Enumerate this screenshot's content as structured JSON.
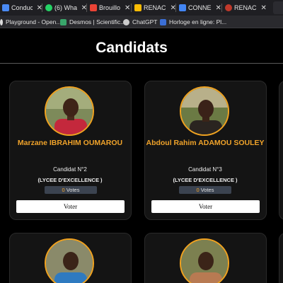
{
  "browser": {
    "tabs": [
      {
        "title": "Conduct",
        "icon": "document-icon",
        "color": "#4a8af4"
      },
      {
        "title": "(6) Wha",
        "icon": "whatsapp-icon",
        "color": "#25d366"
      },
      {
        "title": "Brouillo",
        "icon": "gmail-icon",
        "color": "#ea4335"
      },
      {
        "title": "RENAC",
        "icon": "drive-icon",
        "color": "#fbbc04"
      },
      {
        "title": "CONNE",
        "icon": "document-icon",
        "color": "#4285f4"
      },
      {
        "title": "RENAC",
        "icon": "globe-icon",
        "color": "#c0392b"
      }
    ],
    "bookmarks": [
      {
        "label": "Playground - Open...",
        "icon": "openai-icon",
        "color": "#dddddd"
      },
      {
        "label": "Desmos | Scientific...",
        "icon": "desmos-icon",
        "color": "#39a66b"
      },
      {
        "label": "ChatGPT",
        "icon": "chatgpt-icon",
        "color": "#cccccc"
      },
      {
        "label": "Horloge en ligne: Pl...",
        "icon": "clock-icon",
        "color": "#3b6fd6"
      }
    ]
  },
  "page": {
    "title": "Candidats"
  },
  "candidates": [
    {
      "name": "Marzane IBRAHIM OUMAROU",
      "number": "Candidat N°2",
      "school": "(LYCEE D'EXCELLENCE )",
      "votes": "0",
      "votes_label": "Votes",
      "button": "Voter"
    },
    {
      "name": "Abdoul Rahim ADAMOU SOULEY",
      "number": "Candidat N°3",
      "school": "(LYCEE D'EXCELLENCE )",
      "votes": "0",
      "votes_label": "Votes",
      "button": "Voter"
    }
  ],
  "colors": {
    "accent": "#f0a32a",
    "background": "#000000",
    "card": "#141414",
    "votes_badge": "#3b4350"
  }
}
